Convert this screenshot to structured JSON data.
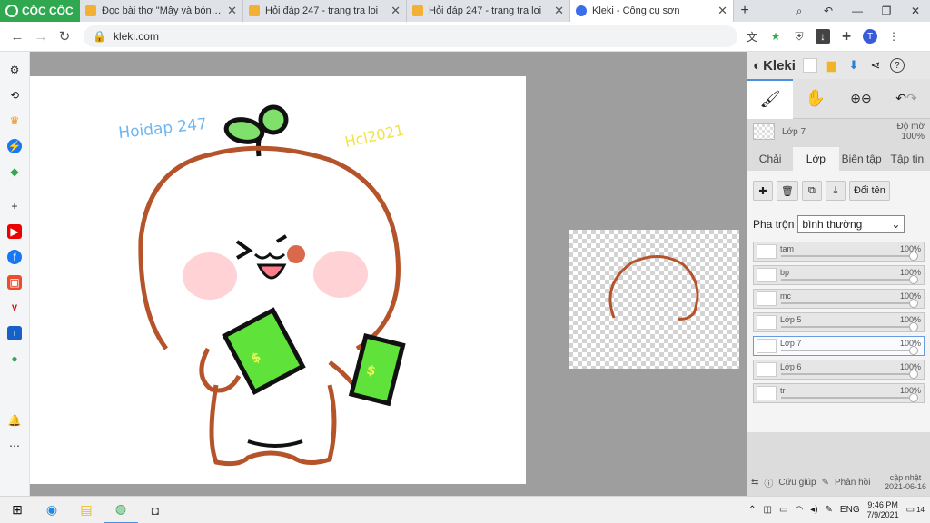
{
  "browser": {
    "brand": "CỐC CỐC",
    "tabs": [
      {
        "title": "Đọc bài thơ \"Mây và bóng\" c",
        "favicon": "coccoc-h-icon",
        "active": false
      },
      {
        "title": "Hỏi đáp 247 - trang tra loi",
        "favicon": "coccoc-h-icon",
        "active": false
      },
      {
        "title": "Hỏi đáp 247 - trang tra loi",
        "favicon": "coccoc-h-icon",
        "active": false
      },
      {
        "title": "Kleki - Công cụ sơn",
        "favicon": "kleki-icon",
        "active": true
      }
    ],
    "url": "kleki.com",
    "avatar_letter": "T"
  },
  "canvas_text": {
    "handwriting_left": "Hoidap 247",
    "handwriting_right": "Hcl2021"
  },
  "panel": {
    "app_name": "Kleki",
    "current_layer": "Lớp 7",
    "opacity_label": "Độ mờ",
    "opacity_value": "100%",
    "tabs": [
      "Chải",
      "Lớp",
      "Biên tập",
      "Tập tin"
    ],
    "active_tab": "Lớp",
    "rename_label": "Đổi tên",
    "blend_label": "Pha trộn",
    "blend_value": "bình thường",
    "layers": [
      {
        "name": "tam",
        "opacity": "100%"
      },
      {
        "name": "bp",
        "opacity": "100%"
      },
      {
        "name": "mc",
        "opacity": "100%"
      },
      {
        "name": "Lớp 5",
        "opacity": "100%"
      },
      {
        "name": "Lớp 7",
        "opacity": "100%",
        "active": true
      },
      {
        "name": "Lớp 6",
        "opacity": "100%"
      },
      {
        "name": "tr",
        "opacity": "100%"
      }
    ],
    "footer": {
      "help": "Cứu giúp",
      "feedback": "Phản hồi",
      "updated_label": "cập nhật",
      "updated_date": "2021-06-16"
    }
  },
  "taskbar": {
    "language": "ENG",
    "time": "9:46 PM",
    "date": "7/9/2021",
    "notification_count": "14"
  },
  "colors": {
    "brand_green": "#2fa84f",
    "accent_blue": "#4a90e2",
    "outline_brown": "#b5532a",
    "money_green": "#5fe23a"
  }
}
